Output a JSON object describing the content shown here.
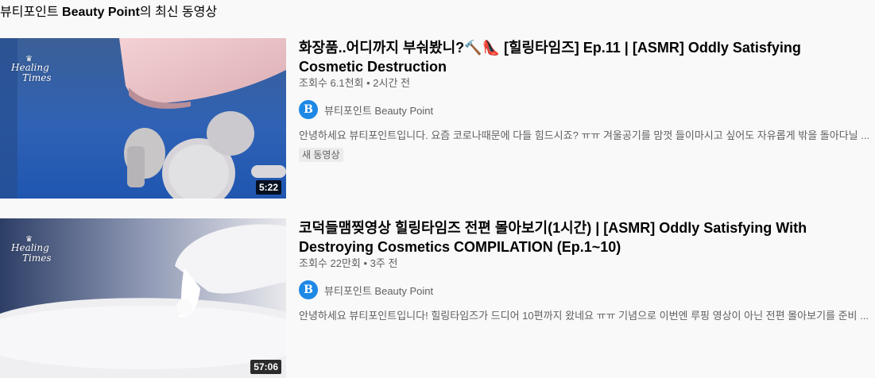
{
  "section": {
    "title_prefix": "뷰티포인트 ",
    "title_bold": "Beauty Point",
    "title_suffix": "의 최신 동영상"
  },
  "videos": [
    {
      "title": "화장품..어디까지 부숴봤니?🔨👠 [힐링타임즈] Ep.11 | [ASMR] Oddly Satisfying Cosmetic Destruction",
      "stats": "조회수 6.1천회 • 2시간 전",
      "channel": "뷰티포인트 Beauty Point",
      "description": "안녕하세요 뷰티포인트입니다. 요즘 코로나때문에 다들 힘드시죠? ㅠㅠ 겨울공기를 맘껏 들이마시고 싶어도 자유롭게 밖을 돌아다닐 ...",
      "badge": "새 동영상",
      "duration": "5:22",
      "thumb_brand_line1": "Healing",
      "thumb_brand_line2": "Times"
    },
    {
      "title": "코덕들맴찢영상 힐링타임즈 전편 몰아보기(1시간) | [ASMR] Oddly Satisfying With Destroying Cosmetics COMPILATION (Ep.1~10)",
      "stats": "조회수 22만회 • 3주 전",
      "channel": "뷰티포인트 Beauty Point",
      "description": "안녕하세요 뷰티포인트입니다! 힐링타임즈가 드디어 10편까지 왔네요 ㅠㅠ 기념으로 이번엔 루핑 영상이 아닌 전편 몰아보기를 준비 ...",
      "duration": "57:06",
      "thumb_brand_line1": "Healing",
      "thumb_brand_line2": "Times"
    }
  ],
  "channel_avatar_letter": "B",
  "colors": {
    "background": "#f9f9f9",
    "secondary_text": "#606060",
    "avatar_blue": "#1e88e5"
  }
}
